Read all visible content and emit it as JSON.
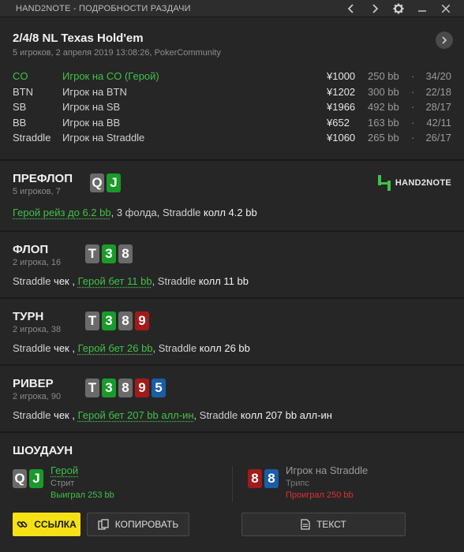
{
  "window": {
    "title": "HAND2NOTE - ПОДРОБНОСТИ РАЗДАЧИ"
  },
  "hand": {
    "title": "2/4/8 NL Texas Hold'em",
    "subtitle": "5 игроков, 2 апреля 2019 13:08:26, PokerCommunity",
    "players": [
      {
        "pos": "CO",
        "name": "Игрок на CO (Герой)",
        "stack": "¥1000",
        "bb": "250 bb",
        "ratio": "34/20",
        "hero": true
      },
      {
        "pos": "BTN",
        "name": "Игрок на BTN",
        "stack": "¥1202",
        "bb": "300 bb",
        "ratio": "22/18",
        "hero": false
      },
      {
        "pos": "SB",
        "name": "Игрок на SB",
        "stack": "¥1966",
        "bb": "492 bb",
        "ratio": "28/17",
        "hero": false
      },
      {
        "pos": "BB",
        "name": "Игрок на BB",
        "stack": "¥652",
        "bb": "163 bb",
        "ratio": "42/11",
        "hero": false
      },
      {
        "pos": "Straddle",
        "name": "Игрок на Straddle",
        "stack": "¥1060",
        "bb": "265 bb",
        "ratio": "26/17",
        "hero": false
      }
    ],
    "dot": "·"
  },
  "logo": {
    "text": "HAND2NOTE"
  },
  "streets": {
    "preflop": {
      "name": "ПРЕФЛОП",
      "sub": "5 игроков, 7",
      "cards": [
        {
          "r": "Q",
          "color": "gray"
        },
        {
          "r": "J",
          "color": "green"
        }
      ],
      "action": {
        "hero": "Герой рейз до 6.2 bb",
        "mid": ", 3 фолда, Straddle ",
        "end": "колл 4.2 bb"
      }
    },
    "flop": {
      "name": "ФЛОП",
      "sub": "2 игрока, 16",
      "cards": [
        {
          "r": "T",
          "color": "gray"
        },
        {
          "r": "3",
          "color": "green"
        },
        {
          "r": "8",
          "color": "gray"
        }
      ],
      "action": {
        "p1": "Straddle ",
        "a1": "чек",
        "sep": " , ",
        "hero": "Герой бет 11 bb",
        "p2": ", Straddle ",
        "a2": "колл 11 bb"
      }
    },
    "turn": {
      "name": "ТУРН",
      "sub": "2 игрока, 38",
      "cards": [
        {
          "r": "T",
          "color": "gray"
        },
        {
          "r": "3",
          "color": "green"
        },
        {
          "r": "8",
          "color": "gray"
        },
        {
          "r": "9",
          "color": "red"
        }
      ],
      "action": {
        "p1": "Straddle ",
        "a1": "чек",
        "sep": " , ",
        "hero": "Герой бет 26 bb",
        "p2": ", Straddle ",
        "a2": "колл 26 bb"
      }
    },
    "river": {
      "name": "РИВЕР",
      "sub": "2 игрока, 90",
      "cards": [
        {
          "r": "T",
          "color": "gray"
        },
        {
          "r": "3",
          "color": "green"
        },
        {
          "r": "8",
          "color": "gray"
        },
        {
          "r": "9",
          "color": "red"
        },
        {
          "r": "5",
          "color": "blue"
        }
      ],
      "action": {
        "p1": "Straddle ",
        "a1": "чек",
        "sep": " , ",
        "hero": "Герой бет 207 bb алл-ин",
        "p2": ", Straddle ",
        "a2": "колл 207 bb алл-ин"
      }
    }
  },
  "showdown": {
    "title": "ШОУДАУН",
    "hero": {
      "name": "Герой",
      "hand": "Стрит",
      "result": "Выиграл 253 bb",
      "cards": [
        {
          "r": "Q",
          "color": "gray"
        },
        {
          "r": "J",
          "color": "green"
        }
      ]
    },
    "villain": {
      "name": "Игрок на Straddle",
      "hand": "Трипс",
      "result": "Проиграл 250 bb",
      "cards": [
        {
          "r": "8",
          "color": "red"
        },
        {
          "r": "8",
          "color": "blue"
        }
      ]
    }
  },
  "buttons": {
    "link": "ССЫЛКА",
    "copy": "КОПИРОВАТЬ",
    "text": "ТЕКСТ"
  },
  "colors": {
    "hero_green": "#3fc247",
    "loss_red": "#e03030",
    "accent_yellow": "#f5e116"
  }
}
